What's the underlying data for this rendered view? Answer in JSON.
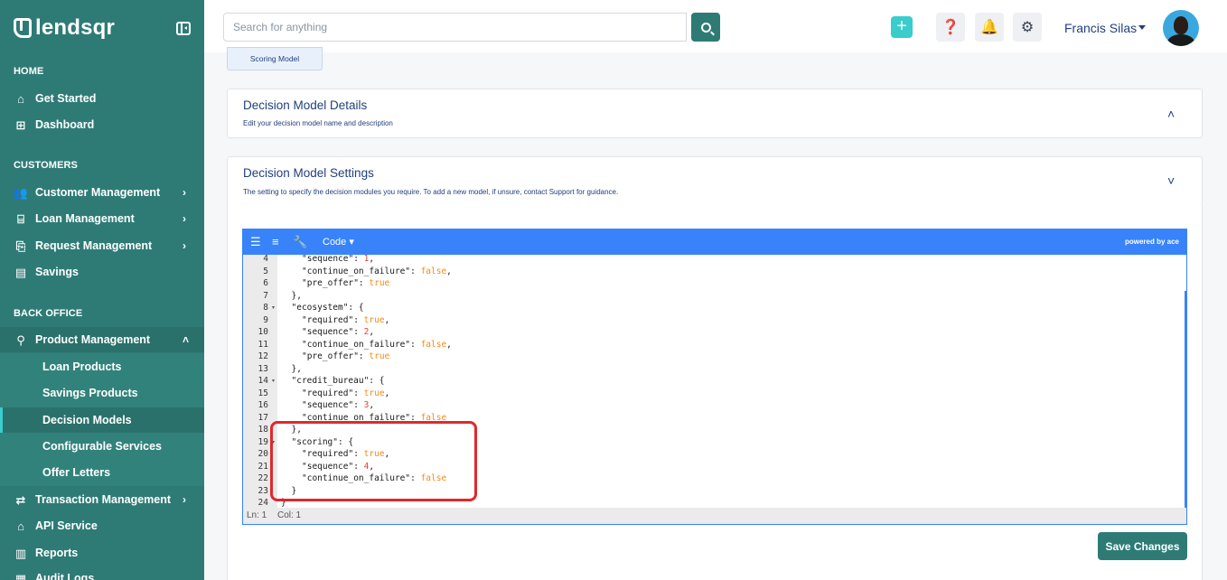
{
  "brand": {
    "name": "lendsqr"
  },
  "sidebar": {
    "sections": {
      "home": "HOME",
      "customers": "CUSTOMERS",
      "back_office": "BACK OFFICE"
    },
    "items": {
      "get_started": "Get Started",
      "dashboard": "Dashboard",
      "customer_management": "Customer Management",
      "loan_management": "Loan Management",
      "request_management": "Request Management",
      "savings": "Savings",
      "product_management": "Product Management",
      "loan_products": "Loan Products",
      "savings_products": "Savings Products",
      "decision_models": "Decision Models",
      "configurable_services": "Configurable Services",
      "offer_letters": "Offer Letters",
      "transaction_management": "Transaction Management",
      "api_service": "API Service",
      "reports": "Reports",
      "audit_logs": "Audit Logs"
    },
    "active_item": "Decision Models"
  },
  "topbar": {
    "search_placeholder": "Search for anything",
    "user_name": "Francis Silas"
  },
  "tabs": {
    "scoring_model": "Scoring Model"
  },
  "cards": {
    "details": {
      "title": "Decision Model Details",
      "subtitle": "Edit your decision model name and description"
    },
    "settings": {
      "title": "Decision Model Settings",
      "subtitle": "The setting to specify the decision modules you require. To add a new model, if unsure, contact Support for guidance."
    }
  },
  "editor": {
    "mode_label": "Code",
    "powered_by": "powered by ace",
    "status_ln": "Ln: 1",
    "status_col": "Col: 1",
    "lines": [
      {
        "n": "4",
        "indent": 2,
        "tokens": [
          [
            "s",
            "\"sequence\""
          ],
          [
            "p",
            ": "
          ],
          [
            "num",
            "1"
          ],
          [
            "p",
            ","
          ]
        ]
      },
      {
        "n": "5",
        "indent": 2,
        "tokens": [
          [
            "s",
            "\"continue_on_failure\""
          ],
          [
            "p",
            ": "
          ],
          [
            "bool",
            "false"
          ],
          [
            "p",
            ","
          ]
        ]
      },
      {
        "n": "6",
        "indent": 2,
        "tokens": [
          [
            "s",
            "\"pre_offer\""
          ],
          [
            "p",
            ": "
          ],
          [
            "bool",
            "true"
          ]
        ]
      },
      {
        "n": "7",
        "indent": 1,
        "tokens": [
          [
            "p",
            "},"
          ]
        ]
      },
      {
        "n": "8",
        "indent": 1,
        "fold": true,
        "tokens": [
          [
            "s",
            "\"ecosystem\""
          ],
          [
            "p",
            ": {"
          ]
        ]
      },
      {
        "n": "9",
        "indent": 2,
        "tokens": [
          [
            "s",
            "\"required\""
          ],
          [
            "p",
            ": "
          ],
          [
            "bool",
            "true"
          ],
          [
            "p",
            ","
          ]
        ]
      },
      {
        "n": "10",
        "indent": 2,
        "tokens": [
          [
            "s",
            "\"sequence\""
          ],
          [
            "p",
            ": "
          ],
          [
            "num",
            "2"
          ],
          [
            "p",
            ","
          ]
        ]
      },
      {
        "n": "11",
        "indent": 2,
        "tokens": [
          [
            "s",
            "\"continue_on_failure\""
          ],
          [
            "p",
            ": "
          ],
          [
            "bool",
            "false"
          ],
          [
            "p",
            ","
          ]
        ]
      },
      {
        "n": "12",
        "indent": 2,
        "tokens": [
          [
            "s",
            "\"pre_offer\""
          ],
          [
            "p",
            ": "
          ],
          [
            "bool",
            "true"
          ]
        ]
      },
      {
        "n": "13",
        "indent": 1,
        "tokens": [
          [
            "p",
            "},"
          ]
        ]
      },
      {
        "n": "14",
        "indent": 1,
        "fold": true,
        "tokens": [
          [
            "s",
            "\"credit_bureau\""
          ],
          [
            "p",
            ": {"
          ]
        ]
      },
      {
        "n": "15",
        "indent": 2,
        "tokens": [
          [
            "s",
            "\"required\""
          ],
          [
            "p",
            ": "
          ],
          [
            "bool",
            "true"
          ],
          [
            "p",
            ","
          ]
        ]
      },
      {
        "n": "16",
        "indent": 2,
        "tokens": [
          [
            "s",
            "\"sequence\""
          ],
          [
            "p",
            ": "
          ],
          [
            "num",
            "3"
          ],
          [
            "p",
            ","
          ]
        ]
      },
      {
        "n": "17",
        "indent": 2,
        "tokens": [
          [
            "s",
            "\"continue_on_failure\""
          ],
          [
            "p",
            ": "
          ],
          [
            "bool",
            "false"
          ]
        ]
      },
      {
        "n": "18",
        "indent": 1,
        "tokens": [
          [
            "p",
            "},"
          ]
        ]
      },
      {
        "n": "19",
        "indent": 1,
        "fold": true,
        "tokens": [
          [
            "s",
            "\"scoring\""
          ],
          [
            "p",
            ": {"
          ]
        ]
      },
      {
        "n": "20",
        "indent": 2,
        "tokens": [
          [
            "s",
            "\"required\""
          ],
          [
            "p",
            ": "
          ],
          [
            "bool",
            "true"
          ],
          [
            "p",
            ","
          ]
        ]
      },
      {
        "n": "21",
        "indent": 2,
        "tokens": [
          [
            "s",
            "\"sequence\""
          ],
          [
            "p",
            ": "
          ],
          [
            "num",
            "4"
          ],
          [
            "p",
            ","
          ]
        ]
      },
      {
        "n": "22",
        "indent": 2,
        "tokens": [
          [
            "s",
            "\"continue_on_failure\""
          ],
          [
            "p",
            ": "
          ],
          [
            "bool",
            "false"
          ]
        ]
      },
      {
        "n": "23",
        "indent": 1,
        "tokens": [
          [
            "p",
            "}"
          ]
        ]
      },
      {
        "n": "24",
        "indent": 0,
        "tokens": [
          [
            "p",
            "}"
          ]
        ]
      }
    ]
  },
  "actions": {
    "save": "Save Changes"
  },
  "colors": {
    "primary": "#2e7b76",
    "accent": "#39cdcc",
    "editor_blue": "#3883fa",
    "highlight_red": "#e0282d",
    "text_navy": "#213f7d"
  },
  "icons": {
    "collapse": "sidebar-collapse-icon",
    "search": "search-icon",
    "add": "plus-icon",
    "help": "help-book-icon",
    "notifications": "bell-icon",
    "settings": "gear-icon"
  }
}
